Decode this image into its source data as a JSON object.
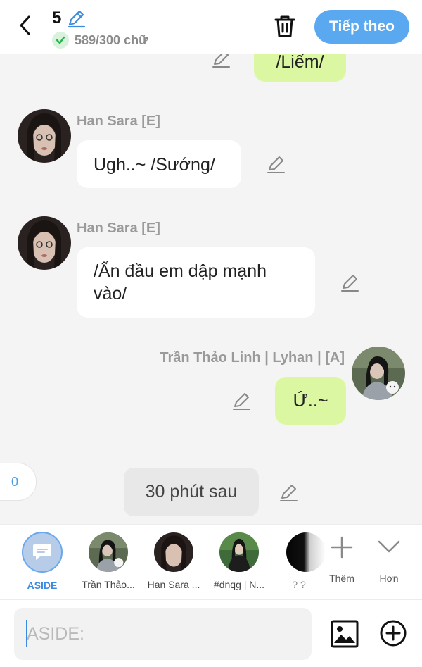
{
  "header": {
    "title_count": "5",
    "status_text": "589/300 chữ",
    "next_label": "Tiếp theo"
  },
  "messages": [
    {
      "type": "outgoing",
      "text": "/Liếm/"
    },
    {
      "type": "incoming",
      "sender": "Han Sara [E]",
      "text": "Ugh..~ /Sướng/"
    },
    {
      "type": "incoming",
      "sender": "Han Sara [E]",
      "text": "/Ấn đầu em dập mạnh vào/"
    },
    {
      "type": "outgoing",
      "sender": "Trần Thảo Linh | Lyhan | [A]",
      "text": "Ứ..~"
    },
    {
      "type": "narration",
      "text": "30 phút sau"
    }
  ],
  "side_counter": "0",
  "character_bar": {
    "aside_label": "ASIDE",
    "characters": [
      {
        "label": "Trần Thảo..."
      },
      {
        "label": "Han Sara ..."
      },
      {
        "label": "#dnqg | N..."
      },
      {
        "label": "? ?"
      }
    ],
    "add_label": "Thêm",
    "more_label": "Hơn"
  },
  "composer": {
    "placeholder": "ASIDE:"
  },
  "colors": {
    "accent": "#5aa8f0",
    "outgoing_bubble": "#dcf7a2",
    "incoming_bubble": "#ffffff",
    "background": "#f4f4f4"
  },
  "icons": [
    "back-icon",
    "pencil-icon",
    "check-icon",
    "trash-icon",
    "image-icon",
    "add-circle-icon",
    "plus-icon",
    "chevron-down-icon"
  ]
}
